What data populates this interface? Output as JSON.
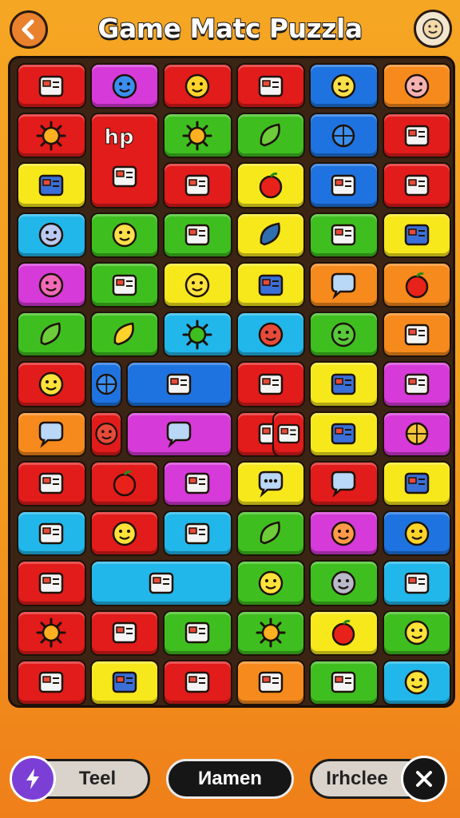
{
  "header": {
    "title": "Game Matc Puzzla",
    "back_icon": "chevron-left-icon",
    "profile_icon": "smiley-face-icon"
  },
  "board": {
    "palette": {
      "red": "#e21b1b",
      "magenta": "#d63ad8",
      "green": "#3fbf1f",
      "blue": "#1e73e0",
      "cyan": "#21b7ea",
      "yellow": "#f7e81c",
      "orange": "#f78a1c",
      "pink": "#f2a6c2"
    },
    "tiles": [
      {
        "color": "red",
        "icon": "radio-icon"
      },
      {
        "color": "magenta",
        "icon": "blue-face-icon"
      },
      {
        "color": "red",
        "icon": "sun-face-icon"
      },
      {
        "color": "red",
        "icon": "duck-icon"
      },
      {
        "color": "blue",
        "icon": "cheese-face-icon"
      },
      {
        "color": "orange",
        "icon": "pig-face-icon"
      },
      {
        "color": "red",
        "icon": "sun-icon"
      },
      {
        "color": "red",
        "icon": "phone-icon",
        "text": "hp"
      },
      {
        "color": "green",
        "icon": "sun-leaf-icon"
      },
      {
        "color": "green",
        "icon": "leaf-icon"
      },
      {
        "color": "blue",
        "icon": "globe-icon"
      },
      {
        "color": "red",
        "icon": "book-icon"
      },
      {
        "color": "yellow",
        "icon": "bag-icon"
      },
      {
        "color": "red",
        "icon": "bow-icon"
      },
      {
        "color": "yellow",
        "icon": "apple-icon"
      },
      {
        "color": "blue",
        "icon": "machine-icon"
      },
      {
        "color": "red",
        "icon": "boxes-icon"
      },
      {
        "color": "cyan",
        "icon": "cloud-face-icon"
      },
      {
        "color": "green",
        "icon": "cat-face-icon"
      },
      {
        "color": "green",
        "icon": "box-icon"
      },
      {
        "color": "yellow",
        "icon": "drop-icon"
      },
      {
        "color": "green",
        "icon": "tape-icon"
      },
      {
        "color": "yellow",
        "icon": "rocket-icon"
      },
      {
        "color": "magenta",
        "icon": "pink-face-icon"
      },
      {
        "color": "green",
        "icon": "tag-icon"
      },
      {
        "color": "yellow",
        "icon": "smiley-icon"
      },
      {
        "color": "yellow",
        "icon": "hand-icon"
      },
      {
        "color": "orange",
        "icon": "chat-icon"
      },
      {
        "color": "orange",
        "icon": "apple-icon"
      },
      {
        "color": "green",
        "icon": "plant-icon"
      },
      {
        "color": "green",
        "icon": "banana-icon"
      },
      {
        "color": "cyan",
        "icon": "germ-icon"
      },
      {
        "color": "cyan",
        "icon": "bug-face-icon"
      },
      {
        "color": "green",
        "icon": "frog-face-icon"
      },
      {
        "color": "orange",
        "icon": "mouse-icon"
      },
      {
        "color": "red",
        "icon": "faces-icon"
      },
      {
        "color": "blue",
        "icon": "egg-icon"
      },
      {
        "color": "blue",
        "icon": "rope-icon"
      },
      {
        "color": "red",
        "icon": "paper-icon"
      },
      {
        "color": "yellow",
        "icon": "basket-icon"
      },
      {
        "color": "magenta",
        "icon": "hand-egg-icon"
      },
      {
        "color": "orange",
        "icon": "chat-splash-icon"
      },
      {
        "color": "red",
        "icon": "bug-face-icon"
      },
      {
        "color": "magenta",
        "icon": "cloud-blob-icon"
      },
      {
        "color": "red",
        "icon": "cage-icon"
      },
      {
        "color": "red",
        "icon": "pizza-icon"
      },
      {
        "color": "yellow",
        "icon": "pen-icon"
      },
      {
        "color": "magenta",
        "icon": "ring-icon"
      },
      {
        "color": "red",
        "icon": "balloon-icon"
      },
      {
        "color": "red",
        "icon": "apple-icon"
      },
      {
        "color": "magenta",
        "icon": "shredder-icon"
      },
      {
        "color": "yellow",
        "icon": "chat-dots-icon"
      },
      {
        "color": "red",
        "icon": "cloud-icon"
      },
      {
        "color": "yellow",
        "icon": "battery-icon"
      },
      {
        "color": "cyan",
        "icon": "calc-icon"
      },
      {
        "color": "red",
        "icon": "smiley-icon"
      },
      {
        "color": "cyan",
        "icon": "ghost-icon"
      },
      {
        "color": "green",
        "icon": "slice-icon"
      },
      {
        "color": "magenta",
        "icon": "peach-face-icon"
      },
      {
        "color": "blue",
        "icon": "sun-face-icon"
      },
      {
        "color": "red",
        "icon": "photo-icon"
      },
      {
        "color": "cyan",
        "icon": "seeds-icon"
      },
      {
        "color": "green",
        "icon": "smiley-icon"
      },
      {
        "color": "green",
        "icon": "chat-face-icon"
      },
      {
        "color": "cyan",
        "icon": "hand-icon"
      },
      {
        "color": "red",
        "icon": "sun-brush-icon"
      },
      {
        "color": "red",
        "icon": "swirl-icon"
      },
      {
        "color": "green",
        "icon": "plant-jar-icon"
      },
      {
        "color": "green",
        "icon": "flower-icon"
      },
      {
        "color": "yellow",
        "icon": "tomato-icon"
      },
      {
        "color": "green",
        "icon": "yellow-face-icon"
      },
      {
        "color": "red",
        "icon": "radio-icon"
      },
      {
        "color": "yellow",
        "icon": "fish-icon"
      },
      {
        "color": "red",
        "icon": "ribbon-icon"
      },
      {
        "color": "orange",
        "icon": "jar-icon"
      },
      {
        "color": "green",
        "icon": "ticket-icon"
      },
      {
        "color": "cyan",
        "icon": "smiley-icon"
      }
    ]
  },
  "bottom_bar": {
    "left_label": "Teel",
    "middle_label": "Иamen",
    "right_label": "Irhclee",
    "left_icon": "lightning-icon",
    "right_icon": "close-icon"
  }
}
